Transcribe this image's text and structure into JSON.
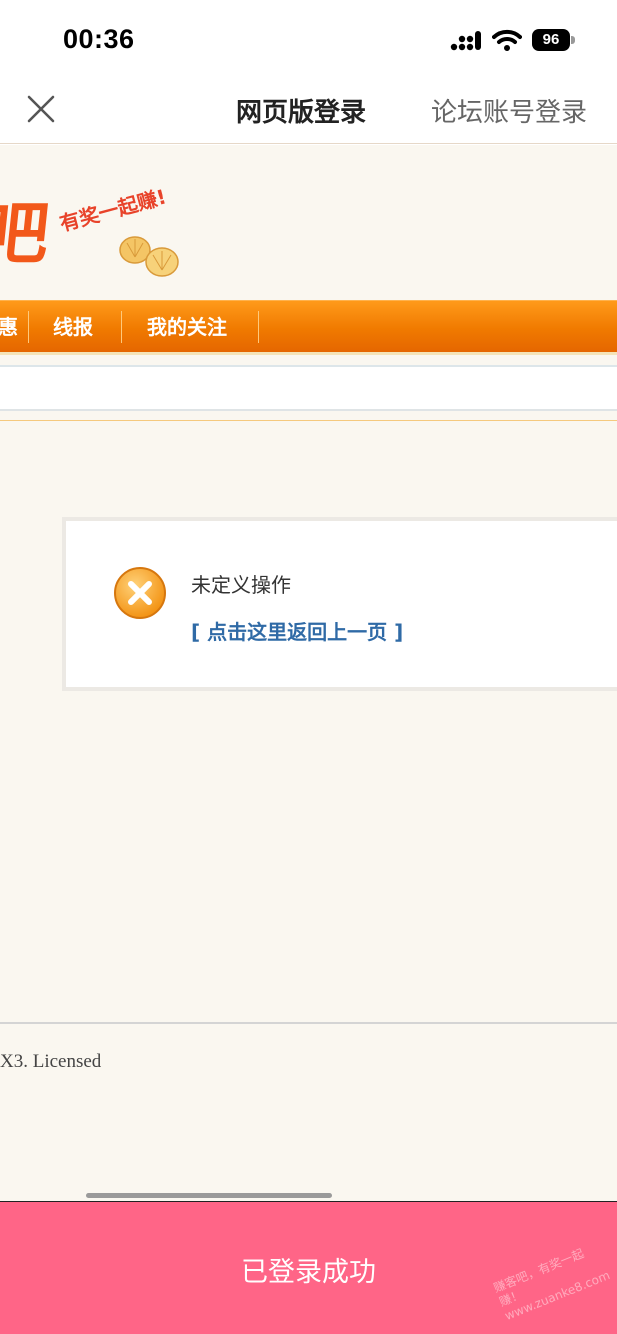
{
  "status_bar": {
    "time": "00:36",
    "battery_level": "96",
    "icons": [
      "signal-icon",
      "wifi-icon",
      "battery-icon"
    ]
  },
  "nav_header": {
    "close_icon": "close-icon",
    "title": "网页版登录",
    "forum_login": "论坛账号登录"
  },
  "site": {
    "logo_char": "吧",
    "slogan": "有奖一起赚!",
    "nav_items": [
      "惠",
      "线报",
      "我的关注"
    ]
  },
  "message": {
    "icon": "error-icon",
    "text": "未定义操作",
    "back_link": "[ 点击这里返回上一页 ]"
  },
  "footer": {
    "text": "X3. Licensed"
  },
  "bottom": {
    "success_text": "已登录成功",
    "watermark_line1": "赚客吧，有奖一起赚！",
    "watermark_line2": "www.zuanke8.com"
  },
  "colors": {
    "nav_orange": "#f07a00",
    "success_pink": "#ff6587",
    "link_blue": "#2f6aa6",
    "page_bg": "#faf7f0"
  }
}
